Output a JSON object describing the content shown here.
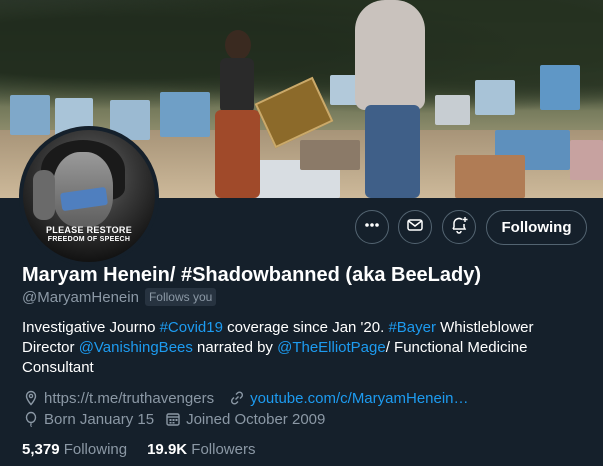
{
  "profile": {
    "name": "Maryam Henein/ #Shadowbanned (aka BeeLady)",
    "handle": "@MaryamHenein",
    "follows_you": "Follows you",
    "bio": {
      "t1": "Investigative Journo ",
      "h1": "#Covid19",
      "t2": " coverage since Jan '20.  ",
      "h2": "#Bayer",
      "t3": " Whistleblower Director ",
      "m1": "@VanishingBees",
      "t4": " narrated by ",
      "m2": "@TheElliotPage",
      "t5": "/ Functional Medicine Consultant"
    },
    "location": "https://t.me/truthavengers",
    "website": "youtube.com/c/MaryamHenein…",
    "birthday": "Born January 15",
    "joined": "Joined October 2009",
    "following_count": "5,379",
    "following_label": "Following",
    "followers_count": "19.9K",
    "followers_label": "Followers"
  },
  "avatar_text": {
    "line1": "PLEASE RESTORE",
    "line2": "FREEDOM OF SPEECH"
  },
  "actions": {
    "more_icon": "more-icon",
    "message_icon": "envelope-icon",
    "notify_icon": "bell-plus-icon",
    "following_label": "Following"
  },
  "colors": {
    "background": "#15202b",
    "accent": "#1d9bf0",
    "muted": "#8b98a5",
    "border": "#536471"
  }
}
